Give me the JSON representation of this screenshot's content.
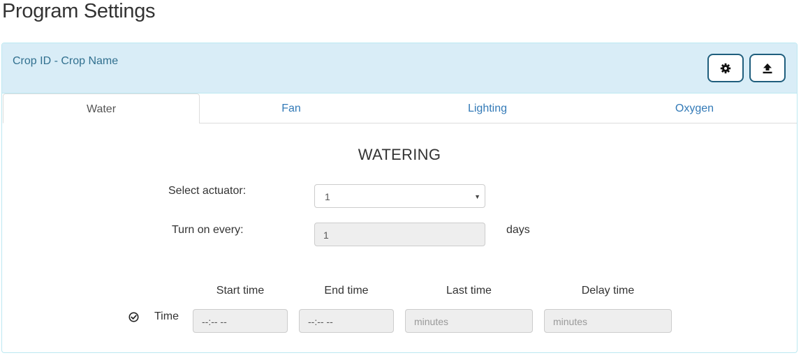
{
  "page": {
    "title": "Program Settings"
  },
  "panel": {
    "crop_title": "Crop ID - Crop Name",
    "buttons": {
      "settings_icon": "gear-icon",
      "upload_icon": "upload-icon"
    }
  },
  "tabs": [
    {
      "label": "Water",
      "active": true
    },
    {
      "label": "Fan",
      "active": false
    },
    {
      "label": "Lighting",
      "active": false
    },
    {
      "label": "Oxygen",
      "active": false
    }
  ],
  "watering": {
    "title": "WATERING",
    "actuator": {
      "label": "Select actuator:",
      "value": "1"
    },
    "turn_on": {
      "label": "Turn on every:",
      "value": "1",
      "unit": "days"
    },
    "schedule": {
      "columns": [
        "Start time",
        "End time",
        "Last time",
        "Delay time"
      ],
      "row": {
        "enabled": true,
        "label": "Time",
        "start_time": "--:-- --",
        "end_time": "--:-- --",
        "last_time_placeholder": "minutes",
        "delay_time_placeholder": "minutes"
      }
    }
  },
  "colors": {
    "accent": "#337ab7",
    "heading_bg": "#d9edf7",
    "heading_text": "#31708f",
    "button_border": "#1f5e7d"
  }
}
